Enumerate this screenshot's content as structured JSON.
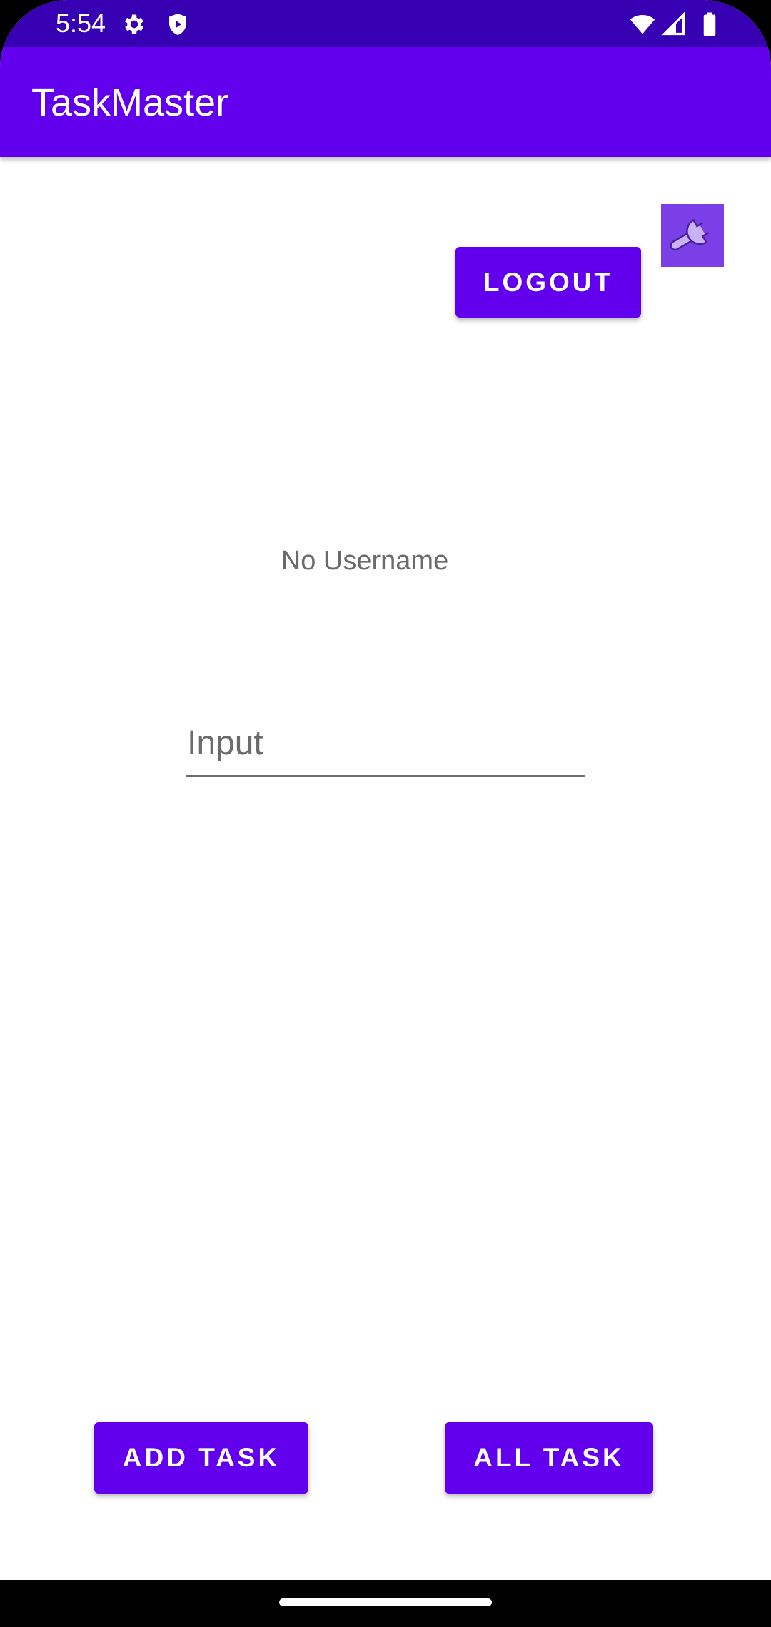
{
  "status_bar": {
    "time": "5:54",
    "left_icons": [
      "gear-icon",
      "shield-play-icon"
    ],
    "right_icons": [
      "wifi-icon",
      "signal-icon",
      "battery-icon"
    ],
    "color": "#3700b3"
  },
  "app_bar": {
    "title": "TaskMaster",
    "color": "#6200ee"
  },
  "toolbar": {
    "logout_label": "LOGOUT",
    "settings_icon": "wrench-icon"
  },
  "profile": {
    "username": "No Username"
  },
  "task_input": {
    "placeholder": "Input",
    "value": ""
  },
  "actions": {
    "add_task_label": "ADD TASK",
    "all_task_label": "ALL TASK"
  }
}
